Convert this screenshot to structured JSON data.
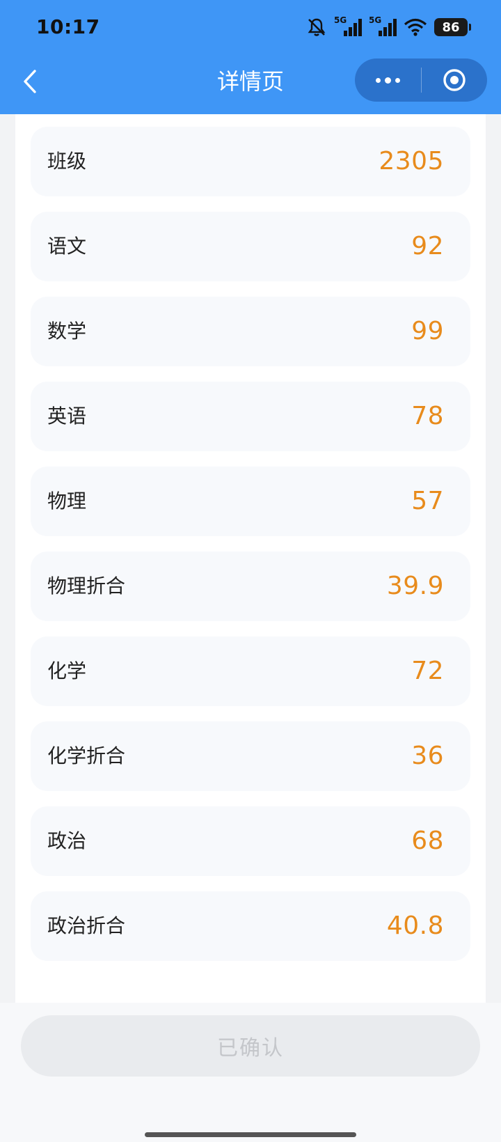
{
  "status_bar": {
    "time": "10:17",
    "signal_label_1": "5G",
    "signal_label_2": "5G",
    "battery": "86",
    "icons": [
      "bell-off-icon",
      "signal-5g-icon",
      "signal-5g-icon",
      "wifi-icon",
      "battery-icon"
    ]
  },
  "nav": {
    "title": "详情页",
    "back_icon": "chevron-left-icon",
    "more_icon": "more-dots-icon",
    "close_icon": "target-circle-icon"
  },
  "rows": [
    {
      "label": "班级",
      "value": "2305"
    },
    {
      "label": "语文",
      "value": "92"
    },
    {
      "label": "数学",
      "value": "99"
    },
    {
      "label": "英语",
      "value": "78"
    },
    {
      "label": "物理",
      "value": "57"
    },
    {
      "label": "物理折合",
      "value": "39.9"
    },
    {
      "label": "化学",
      "value": "72"
    },
    {
      "label": "化学折合",
      "value": "36"
    },
    {
      "label": "政治",
      "value": "68"
    },
    {
      "label": "政治折合",
      "value": "40.8"
    }
  ],
  "footer": {
    "confirm_label": "已确认"
  },
  "colors": {
    "header_blue": "#3f96f6",
    "value_orange": "#e88b1c",
    "row_background": "#f7f9fc"
  }
}
